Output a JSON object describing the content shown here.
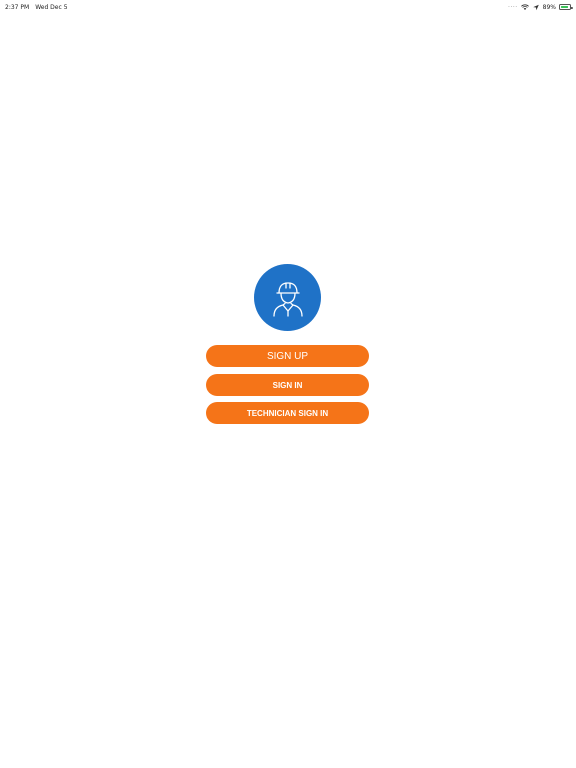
{
  "status_bar": {
    "time": "2:37 PM",
    "date": "Wed Dec 5",
    "battery": "89%",
    "battery_level": 0.89,
    "icons": [
      "signal-dots-icon",
      "wifi-icon",
      "location-icon",
      "battery-icon"
    ]
  },
  "logo": {
    "icon": "technician-hardhat-icon",
    "bg_color": "#1f72c7"
  },
  "buttons": {
    "signup_label": "SIGN UP",
    "signin_label": "SIGN IN",
    "technician_signin_label": "TECHNICIAN SIGN IN",
    "color": "#f57418"
  }
}
